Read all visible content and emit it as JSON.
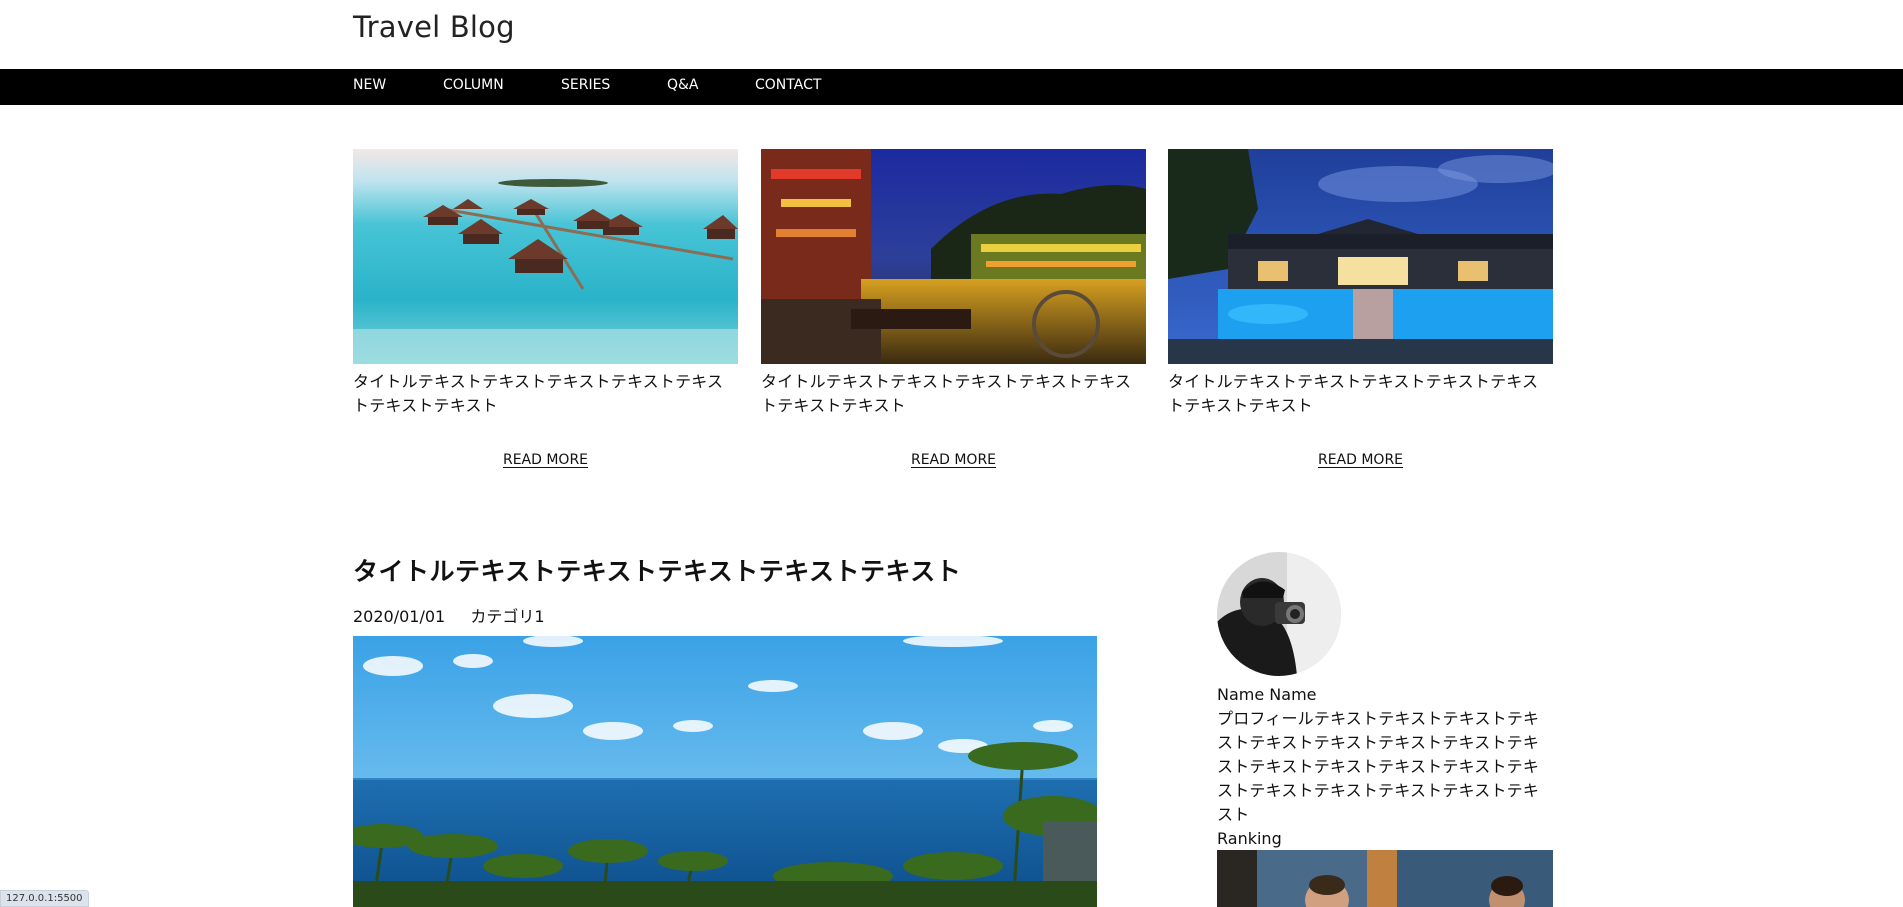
{
  "site": {
    "title": "Travel Blog"
  },
  "nav": [
    {
      "label": "NEW"
    },
    {
      "label": "COLUMN"
    },
    {
      "label": "SERIES"
    },
    {
      "label": "Q&A"
    },
    {
      "label": "CONTACT"
    }
  ],
  "cards": [
    {
      "title": "タイトルテキストテキストテキストテキストテキストテキストテキスト",
      "read_more": "READ MORE"
    },
    {
      "title": "タイトルテキストテキストテキストテキストテキストテキストテキスト",
      "read_more": "READ MORE"
    },
    {
      "title": "タイトルテキストテキストテキストテキストテキストテキストテキスト",
      "read_more": "READ MORE"
    }
  ],
  "article": {
    "title": "タイトルテキストテキストテキストテキストテキスト",
    "date": "2020/01/01",
    "category": "カテゴリ1"
  },
  "sidebar": {
    "name": "Name Name",
    "profile_text": "プロフィールテキストテキストテキストテキストテキストテキストテキストテキストテキストテキストテキストテキストテキストテキストテキストテキストテキストテキストテキスト",
    "ranking_label": "Ranking"
  },
  "status_bar": {
    "url": "127.0.0.1:5500"
  }
}
